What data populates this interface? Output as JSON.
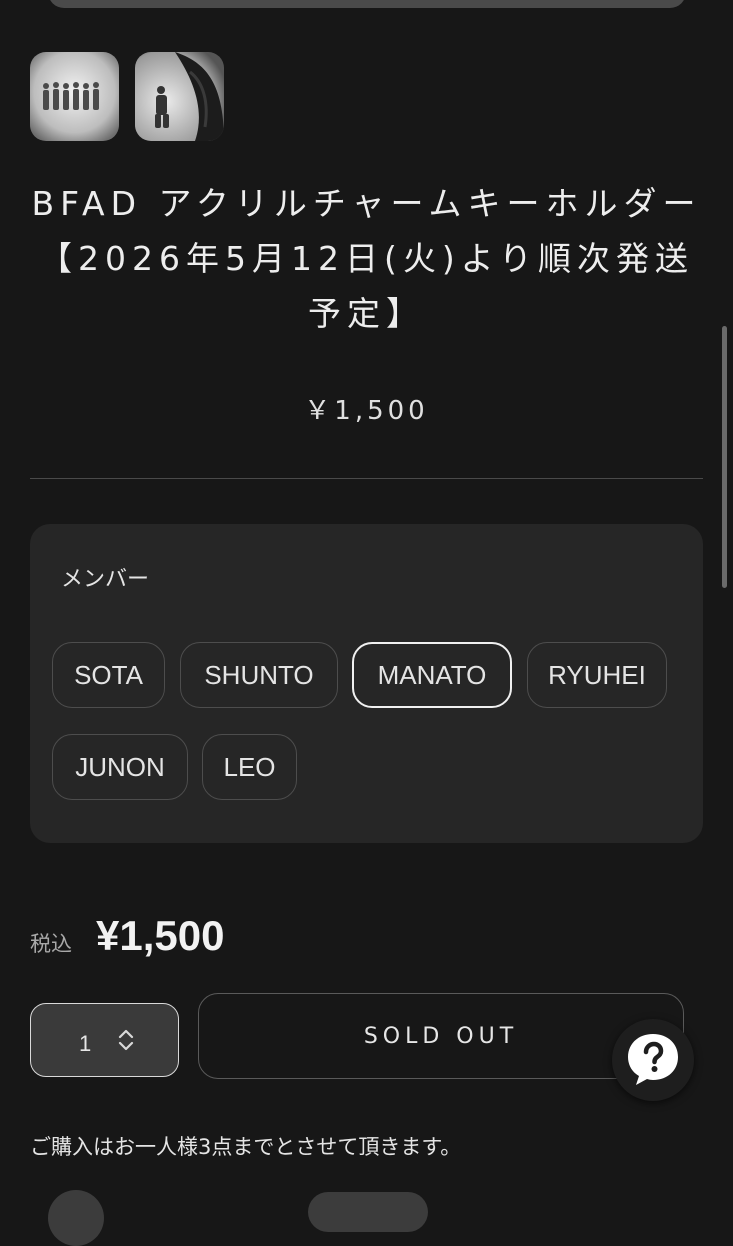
{
  "product": {
    "title": "BFAD アクリルチャームキーホルダー【2026年5月12日(火)より順次発送予定】",
    "price_display": "￥1,500"
  },
  "thumbnails": [
    {
      "icon": "product-photo-group-icon"
    },
    {
      "icon": "product-photo-member-icon"
    }
  ],
  "variant": {
    "label": "メンバー",
    "options": [
      "SOTA",
      "SHUNTO",
      "MANATO",
      "RYUHEI",
      "JUNON",
      "LEO"
    ],
    "selected": "MANATO"
  },
  "purchase": {
    "tax_label": "税込",
    "price": "¥1,500",
    "quantity": "1",
    "button_label": "SOLD OUT"
  },
  "note": "ご購入はお一人様3点までとさせて頂きます。",
  "colors": {
    "background": "#171717",
    "card": "#262626",
    "text": "#e6e6e6",
    "selected_border": "#f0f0f0"
  },
  "icons": {
    "help": "help-chat-icon",
    "quantity": "chevron-up-down-icon"
  }
}
